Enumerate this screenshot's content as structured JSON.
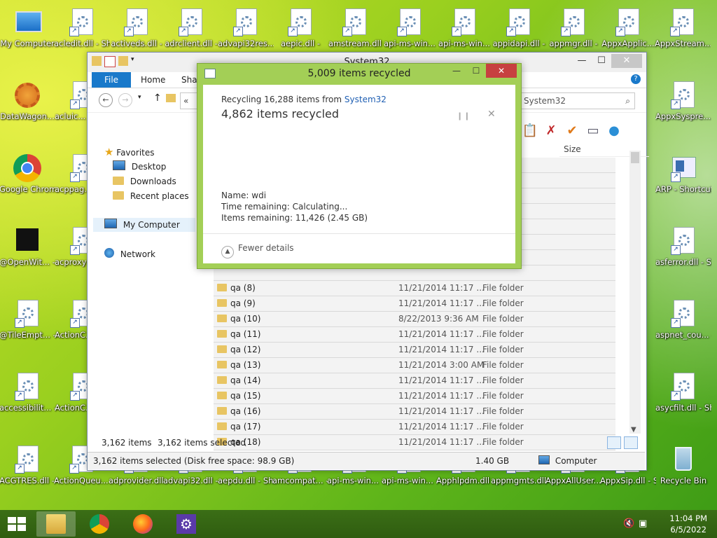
{
  "desktop": {
    "icons_top": [
      {
        "label": "My Computer",
        "type": "pc"
      },
      {
        "label": "acledit.dll - Short",
        "type": "dll"
      },
      {
        "label": "activeds.dll -",
        "type": "dll"
      },
      {
        "label": "adrclient.dll -",
        "type": "dll"
      },
      {
        "label": "advapi32res...",
        "type": "dll"
      },
      {
        "label": "aepic.dll -",
        "type": "dll"
      },
      {
        "label": "amstream.dll",
        "type": "dll"
      },
      {
        "label": "api-ms-win...",
        "type": "dll"
      },
      {
        "label": "api-ms-win...",
        "type": "dll"
      },
      {
        "label": "appidapi.dll -",
        "type": "dll"
      },
      {
        "label": "appmgr.dll -",
        "type": "dll"
      },
      {
        "label": "AppxApplic...",
        "type": "dll"
      },
      {
        "label": "AppxStream... - Shortcut",
        "type": "dll"
      }
    ],
    "icons_left": [
      {
        "label": "DataWagon...",
        "type": "sun"
      },
      {
        "label": "Google Chrome",
        "type": "chrome"
      },
      {
        "label": "@OpenWit... - Shortcut",
        "type": "black"
      },
      {
        "label": "@TileEmpt... - Shortcut",
        "type": "dll"
      },
      {
        "label": "accessibilit... - Shortcut",
        "type": "dll"
      },
      {
        "label": "ACGTRES.dll - Shortcut",
        "type": "dll"
      }
    ],
    "icons_col2": [
      {
        "label": "acluic... - Shortc",
        "type": "dll"
      },
      {
        "label": "acppag... - Shortc",
        "type": "dll"
      },
      {
        "label": "acproxy - Shor",
        "type": "dll"
      },
      {
        "label": "ActionC... - Shor",
        "type": "dll"
      },
      {
        "label": "ActionC... - Shor",
        "type": "dll"
      }
    ],
    "icons_right": [
      {
        "label": "AppxSyspre... - Shortcut",
        "type": "dll"
      },
      {
        "label": "ARP - Shortcut",
        "type": "arp"
      },
      {
        "label": "asferror.dll - Shortcut",
        "type": "dll"
      },
      {
        "label": "aspnet_cou... - Shortcut",
        "type": "dll"
      },
      {
        "label": "asycfilt.dll - Shortcut",
        "type": "dll"
      },
      {
        "label": "Recycle Bin",
        "type": "bin"
      }
    ],
    "icons_bottom": [
      {
        "label": "ActionQueu... - Shortcut",
        "type": "dll"
      },
      {
        "label": "adprovider.dll - Shortcut",
        "type": "dll"
      },
      {
        "label": "advapi32.dll - Shortcut",
        "type": "dll"
      },
      {
        "label": "aepdu.dll - Shortcut",
        "type": "dll"
      },
      {
        "label": "amcompat... - Shortcut",
        "type": "dll"
      },
      {
        "label": "api-ms-win... - Shortcut",
        "type": "dll"
      },
      {
        "label": "api-ms-win... - Shortcut",
        "type": "dll"
      },
      {
        "label": "Apphlpdm.dll - Shortcut",
        "type": "dll"
      },
      {
        "label": "appmgmts.dll - Shortcut",
        "type": "dll"
      },
      {
        "label": "AppxAllUser... - Shortcut",
        "type": "dll"
      },
      {
        "label": "AppxSip.dll - Shortcut",
        "type": "dll"
      }
    ]
  },
  "explorer": {
    "title": "System32",
    "tabs": {
      "file": "File",
      "home": "Home",
      "share": "Shar"
    },
    "address_prefix": "«",
    "search_placeholder": "System32",
    "column_size": "Size",
    "nav": {
      "favorites": "Favorites",
      "desktop": "Desktop",
      "downloads": "Downloads",
      "recent": "Recent places",
      "computer": "My Computer",
      "network": "Network"
    },
    "rows": [
      {
        "name": "qa (8)",
        "date": "11/21/2014 11:17 ...",
        "type": "File folder"
      },
      {
        "name": "qa (9)",
        "date": "11/21/2014 11:17 ...",
        "type": "File folder"
      },
      {
        "name": "qa (10)",
        "date": "8/22/2013 9:36 AM",
        "type": "File folder"
      },
      {
        "name": "qa (11)",
        "date": "11/21/2014 11:17 ...",
        "type": "File folder"
      },
      {
        "name": "qa (12)",
        "date": "11/21/2014 11:17 ...",
        "type": "File folder"
      },
      {
        "name": "qa (13)",
        "date": "11/21/2014 3:00 AM",
        "type": "File folder"
      },
      {
        "name": "qa (14)",
        "date": "11/21/2014 11:17 ...",
        "type": "File folder"
      },
      {
        "name": "qa (15)",
        "date": "11/21/2014 11:17 ...",
        "type": "File folder"
      },
      {
        "name": "qa (16)",
        "date": "11/21/2014 11:17 ...",
        "type": "File folder"
      },
      {
        "name": "qa (17)",
        "date": "11/21/2014 11:17 ...",
        "type": "File folder"
      },
      {
        "name": "qa (18)",
        "date": "11/21/2014 11:17 ...",
        "type": "File folder"
      }
    ],
    "status_items": "3,162 items",
    "status_selected": "3,162 items selected",
    "status_bar": "3,162 items selected (Disk free space: 98.9 GB)",
    "status_size": "1.40 GB",
    "status_location": "Computer"
  },
  "dialog": {
    "title": "5,009 items recycled",
    "line1_prefix": "Recycling 16,288 items from ",
    "line1_link": "System32",
    "line2": "4,862 items recycled",
    "name_label": "Name:  wdi",
    "time_label": "Time remaining:  Calculating...",
    "items_label": "Items remaining:  11,426 (2.45 GB)",
    "fewer_details": "Fewer details"
  },
  "taskbar": {
    "time": "11:04 PM",
    "date": "6/5/2022"
  }
}
